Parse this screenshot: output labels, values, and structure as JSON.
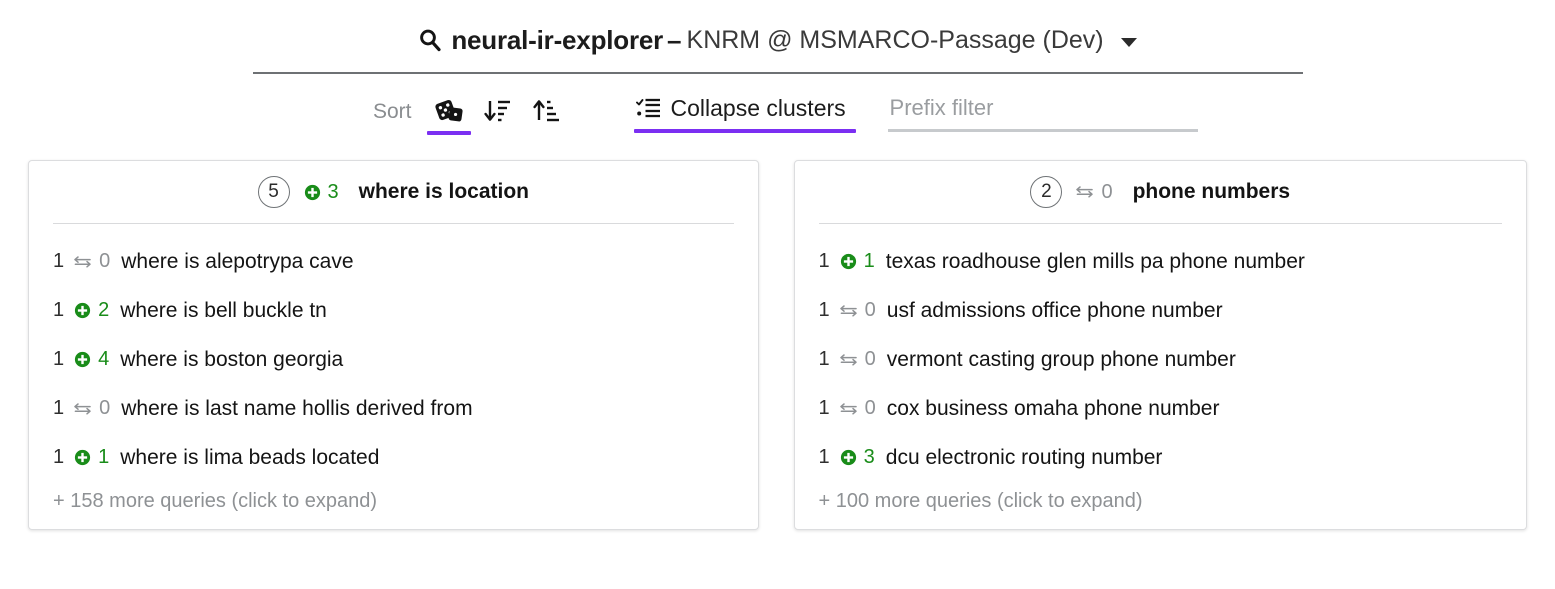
{
  "header": {
    "search_icon": "search-icon",
    "app_name": "neural-ir-explorer",
    "separator": "–",
    "model": "KNRM @ MSMARCO-Passage (Dev)",
    "caret_icon": "chevron-down-icon"
  },
  "toolbar": {
    "sort_label": "Sort",
    "sort_buttons": [
      {
        "icon": "dice-icon",
        "name": "sort-random-button",
        "active": true
      },
      {
        "icon": "sort-descending-icon",
        "name": "sort-descending-button",
        "active": false
      },
      {
        "icon": "sort-ascending-icon",
        "name": "sort-ascending-button",
        "active": false
      }
    ],
    "collapse_icon": "checklist-icon",
    "collapse_label": "Collapse clusters",
    "collapse_active": true,
    "prefix_filter_placeholder": "Prefix filter",
    "prefix_filter_value": "",
    "accent_color": "#7b2ff2"
  },
  "clusters": [
    {
      "count": "5",
      "badge_icon": "plus-circle-icon",
      "badge_value": "3",
      "badge_color": "green",
      "title": "where is location",
      "more_label": "+ 158 more queries (click to expand)",
      "queries": [
        {
          "rank": "1",
          "badge_icon": "exchange-icon",
          "badge_value": "0",
          "badge_color": "gray",
          "text": "where is alepotrypa cave"
        },
        {
          "rank": "1",
          "badge_icon": "plus-circle-icon",
          "badge_value": "2",
          "badge_color": "green",
          "text": "where is bell buckle tn"
        },
        {
          "rank": "1",
          "badge_icon": "plus-circle-icon",
          "badge_value": "4",
          "badge_color": "green",
          "text": "where is boston georgia"
        },
        {
          "rank": "1",
          "badge_icon": "exchange-icon",
          "badge_value": "0",
          "badge_color": "gray",
          "text": "where is last name hollis derived from"
        },
        {
          "rank": "1",
          "badge_icon": "plus-circle-icon",
          "badge_value": "1",
          "badge_color": "green",
          "text": "where is lima beads located"
        }
      ]
    },
    {
      "count": "2",
      "badge_icon": "exchange-icon",
      "badge_value": "0",
      "badge_color": "gray",
      "title": "phone numbers",
      "more_label": "+ 100 more queries (click to expand)",
      "queries": [
        {
          "rank": "1",
          "badge_icon": "plus-circle-icon",
          "badge_value": "1",
          "badge_color": "green",
          "text": "texas roadhouse glen mills pa phone number"
        },
        {
          "rank": "1",
          "badge_icon": "exchange-icon",
          "badge_value": "0",
          "badge_color": "gray",
          "text": "usf admissions office phone number"
        },
        {
          "rank": "1",
          "badge_icon": "exchange-icon",
          "badge_value": "0",
          "badge_color": "gray",
          "text": "vermont casting group phone number"
        },
        {
          "rank": "1",
          "badge_icon": "exchange-icon",
          "badge_value": "0",
          "badge_color": "gray",
          "text": "cox business omaha phone number"
        },
        {
          "rank": "1",
          "badge_icon": "plus-circle-icon",
          "badge_value": "3",
          "badge_color": "green",
          "text": "dcu electronic routing number"
        }
      ]
    }
  ]
}
